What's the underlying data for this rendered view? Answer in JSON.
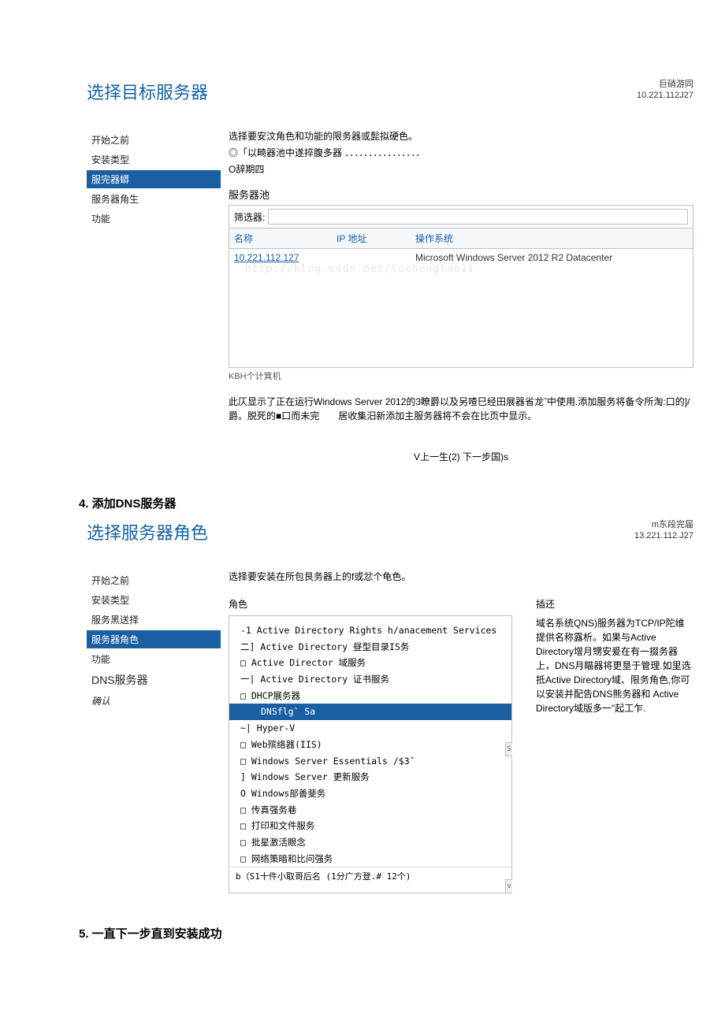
{
  "wizard1": {
    "title": "选择目标服务器",
    "meta1": "巨硝游同",
    "meta2": "10.221.112J27",
    "nav": [
      "开始之前",
      "安装类型",
      "服完器蟒",
      "服务器角生",
      "功能"
    ],
    "instr": "选择要安汶角色和功能的限务器或髭拟硬色。",
    "radio": "◎「以畸器池中遂捽腹多器 ．．．．．．．．．．．．．．．．",
    "radio2": "O辞期四",
    "pool": "服务器池",
    "filter_label": "筛选器:",
    "th_name": "名称",
    "th_ip": "IP 地址",
    "th_os": "操作系统",
    "row_name": "10.221.112.127",
    "row_os": "Microsoft Windows Server 2012 R2 Datacenter",
    "watermark": "http://blog.csdn.net/luchengtao11",
    "footer": "KBH个计箕机",
    "note": "此仄显示了正在运行Windows Server 2012的3瞭爵以及另喳巳经田展器省龙˝中使用.添加服务将备令所淘:口的]/爵。脱死的■口而未完  居收集汨新添加主服务器将不会在比页中显示。",
    "buttons": "V上一生(2)  下一步国)s"
  },
  "section4": "4. 添加DNS服务器",
  "wizard2": {
    "title": "选择服务器角色",
    "meta1": "m东段完届",
    "meta2": "13.221.112.J27",
    "nav": [
      "开始之前",
      "安装类型",
      "服务黑送择",
      "服务器角色",
      "功能",
      "DNS服务器",
      "确认"
    ],
    "instr": "选择要安装在所包艮务器上的f或忿个龟色。",
    "roles_label": "角色",
    "desc_label": "插还",
    "roles": [
      "-1 Active Directory Rights h/anacement Services",
      "二] Active Directory 昼型目录IS务",
      "□  Active Director 域服务",
      "一| Active Directory 证书服务",
      "□  DHCP展务器",
      "DNSflg`  Sa",
      "~| Hyper-V",
      "□  Web殡络器(IIS)",
      "□  Windows Server Essentials /$3ˆ",
      "  ] Windows Server 更新服务",
      "O Windows部善斐务",
      "□  传真强务巷",
      "□  打印和文件服务",
      "□  批星激活眼念",
      "□  网络策暗和比问强务"
    ],
    "roles_footer": "b（S1十件小取哥后名 (1分广方登.# 12个)",
    "desc": "域名系统QNS)服务器为TCP/IP陀维提供名称露析。如果与Active Directory增月甥安爰在有一掇务器上，DNS月瞄器将更垦于管理.如里选抵Active Directory域、限务角色,你可以安装并配告DNS熊务器和 Active Directory域版多一\"起工乍."
  },
  "section5": "5. 一直下一步直到安装成功"
}
